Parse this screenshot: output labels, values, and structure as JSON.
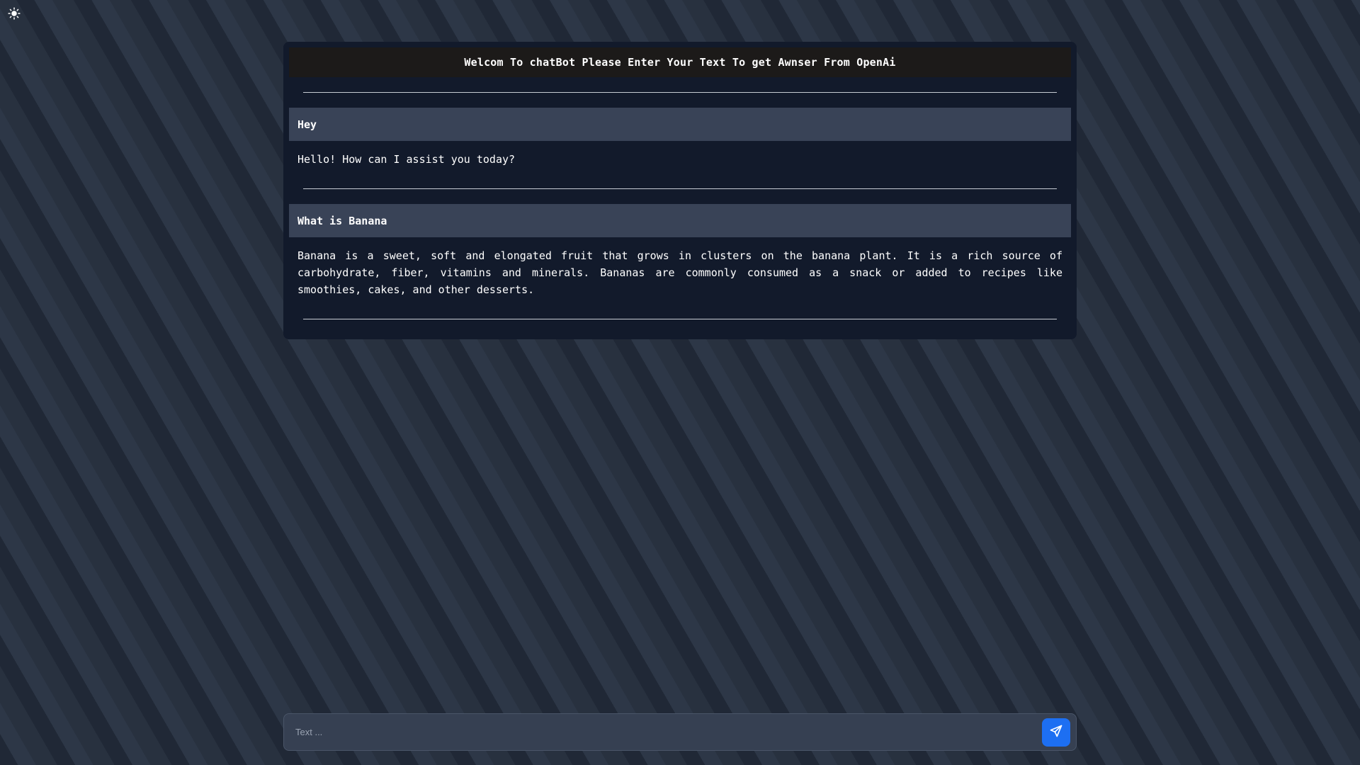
{
  "theme_toggle": {
    "icon": "sun-icon"
  },
  "chat": {
    "header": "Welcom To chatBot Please Enter Your Text To get Awnser From OpenAi",
    "messages": [
      {
        "user": "Hey",
        "bot": "Hello! How can I assist you today?"
      },
      {
        "user": "What is Banana",
        "bot": "Banana is a sweet, soft and elongated fruit that grows in clusters on the banana plant. It is a rich source of carbohydrate, fiber, vitamins and minerals. Bananas are commonly consumed as a snack or added to recipes like smoothies, cakes, and other desserts."
      }
    ]
  },
  "input": {
    "placeholder": "Text ...",
    "value": ""
  },
  "send_button": {
    "icon": "send-icon"
  },
  "colors": {
    "panel": "#121a2b",
    "header": "#1c1a19",
    "user_bubble": "#394357",
    "accent": "#1d6ff2"
  }
}
